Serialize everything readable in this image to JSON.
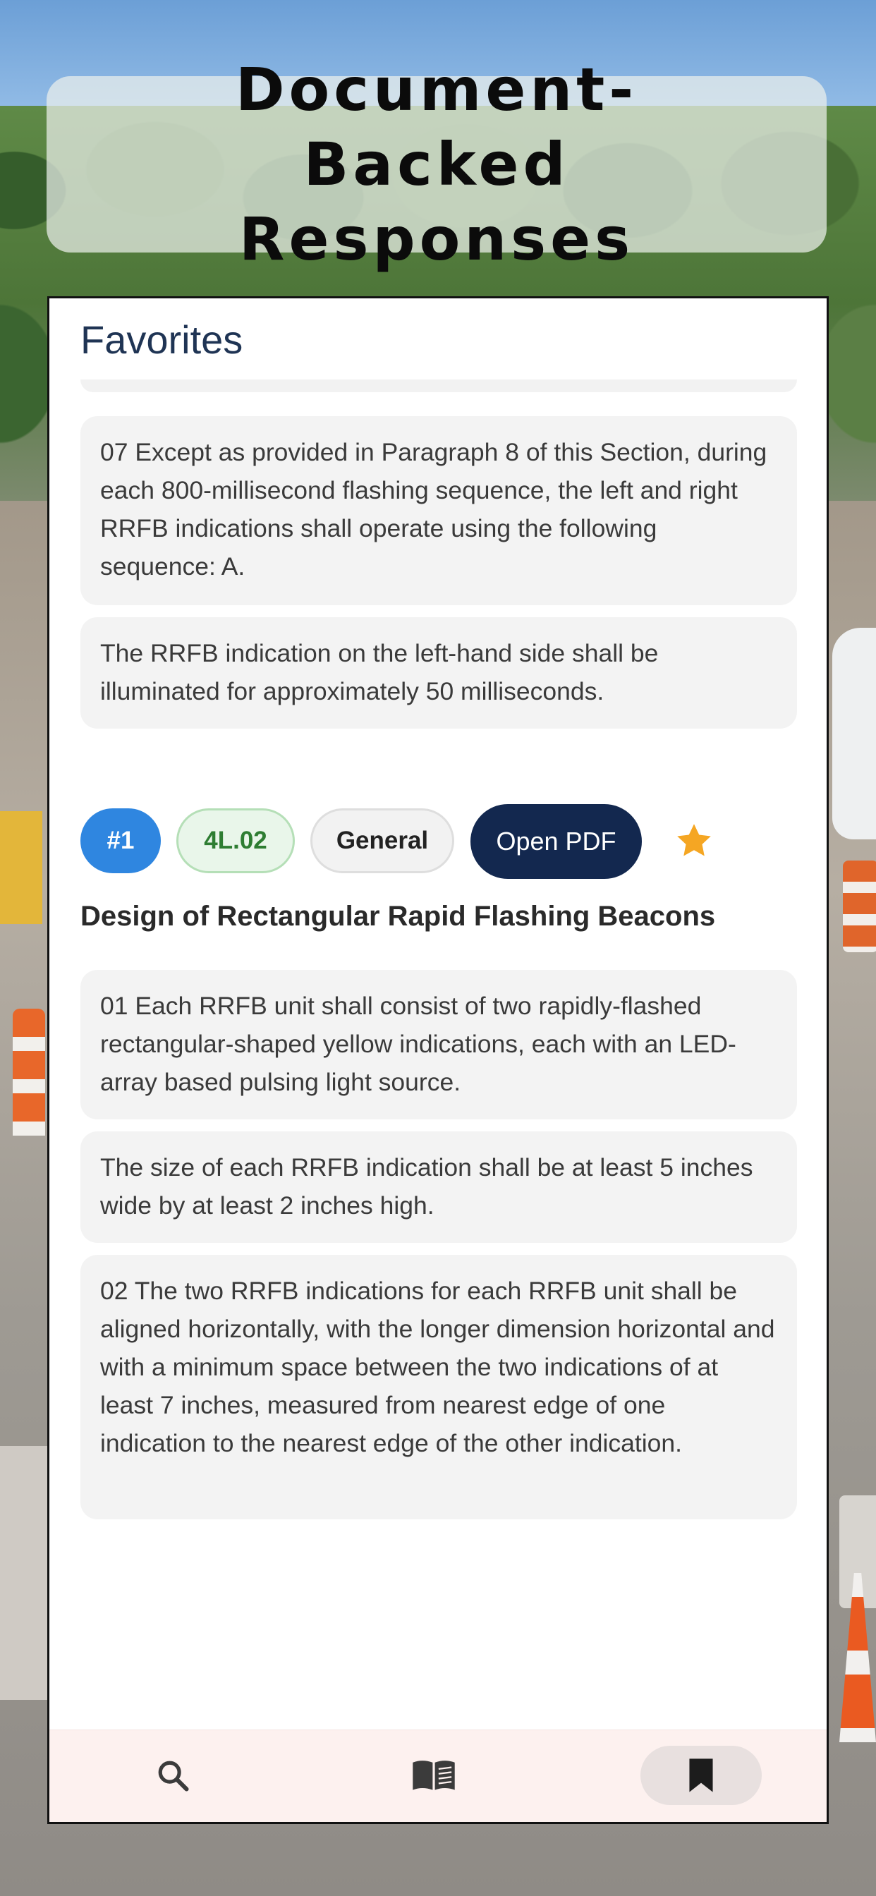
{
  "title": "Document-Backed Responses",
  "panel": {
    "heading": "Favorites"
  },
  "previous_result": {
    "paragraphs": [
      "07  Except as provided in Paragraph 8 of this Section, during each 800-millisecond flashing sequence, the left and right RRFB indications shall operate using the following sequence: A.",
      "The RRFB indication on the left-hand side shall be illuminated for approximately 50 milliseconds."
    ]
  },
  "result": {
    "rank": "#1",
    "section": "4L.02",
    "category": "General",
    "open_pdf_label": "Open PDF",
    "favorited": true,
    "heading": "Design of Rectangular Rapid Flashing Beacons",
    "paragraphs": [
      "01  Each RRFB unit shall consist of two rapidly-flashed rectangular-shaped yellow indications, each with  an LED-array based pulsing light source.",
      "The size of each RRFB indication shall be at least 5 inches wide  by at least 2 inches high.",
      "02  The two RRFB indications for each RRFB unit shall be aligned horizontally, with the longer dimension horizontal and with a minimum space between the two indications of at least 7 inches, measured from  nearest edge of one indication to the nearest edge of the other indication."
    ]
  },
  "nav": {
    "items": [
      {
        "icon": "search-icon",
        "active": false
      },
      {
        "icon": "book-icon",
        "active": false
      },
      {
        "icon": "bookmark-icon",
        "active": true
      }
    ]
  },
  "colors": {
    "rank_chip": "#2f86e0",
    "section_chip_text": "#2e7d32",
    "open_pdf_button": "#13284f",
    "star": "#f5a623",
    "panel_title": "#1f3454"
  }
}
